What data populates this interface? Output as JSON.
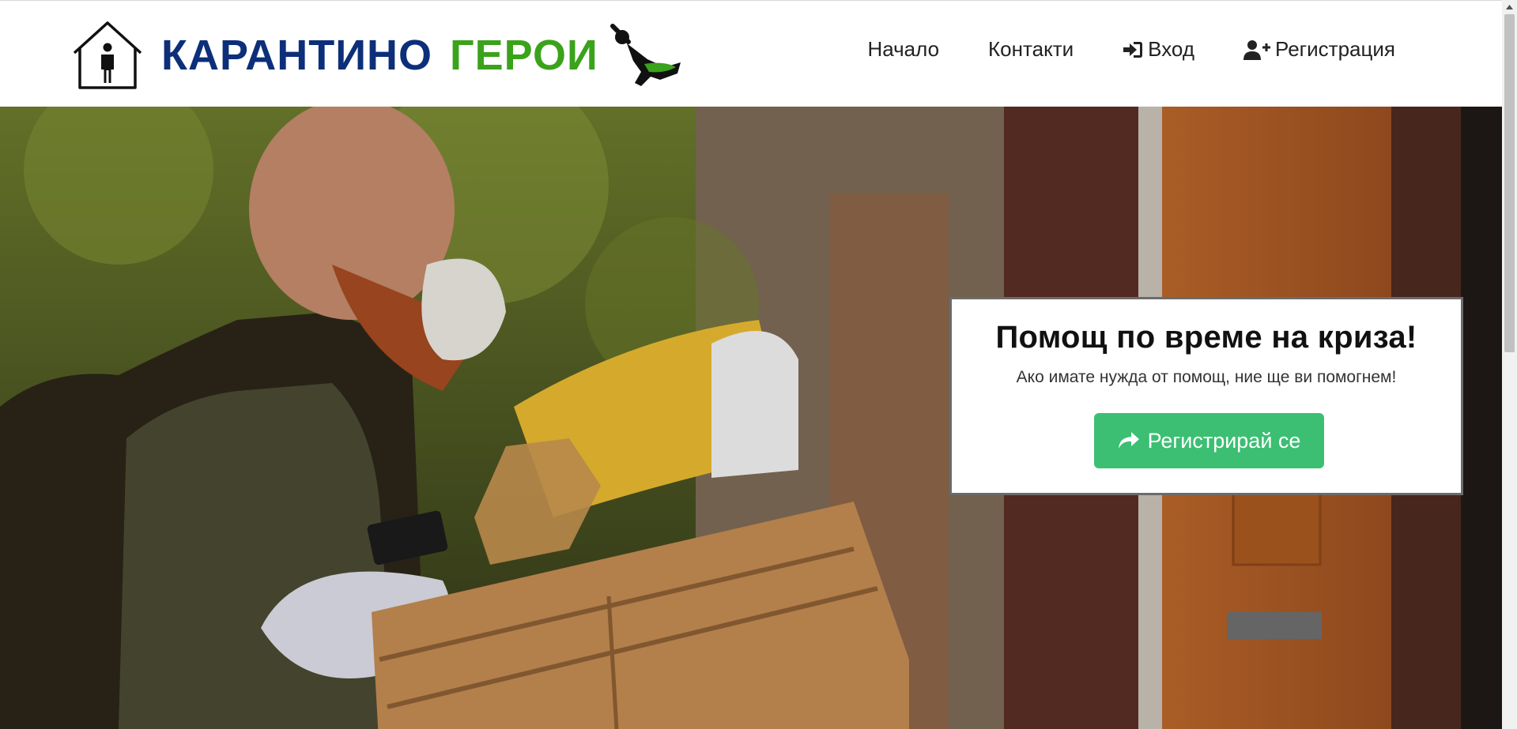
{
  "brand": {
    "word1": "КАРАНТИНО",
    "word2": "ГЕРОИ",
    "colors": {
      "word1": "#0d2f7a",
      "word2": "#3ba21b"
    },
    "icons": [
      "house-person-icon",
      "flying-hero-icon"
    ]
  },
  "nav": {
    "items": [
      {
        "label": "Начало",
        "icon": ""
      },
      {
        "label": "Контакти",
        "icon": ""
      },
      {
        "label": "Вход",
        "icon": "sign-in-icon"
      },
      {
        "label": "Регистрация",
        "icon": "user-plus-icon"
      }
    ]
  },
  "cta": {
    "title": "Помощ по време на криза!",
    "subtitle": "Ако имате нужда от помощ, ние ще ви помогнем!",
    "button_label": "Регистрирай се",
    "button_icon": "share-arrow-icon",
    "button_color": "#3cbf73"
  }
}
